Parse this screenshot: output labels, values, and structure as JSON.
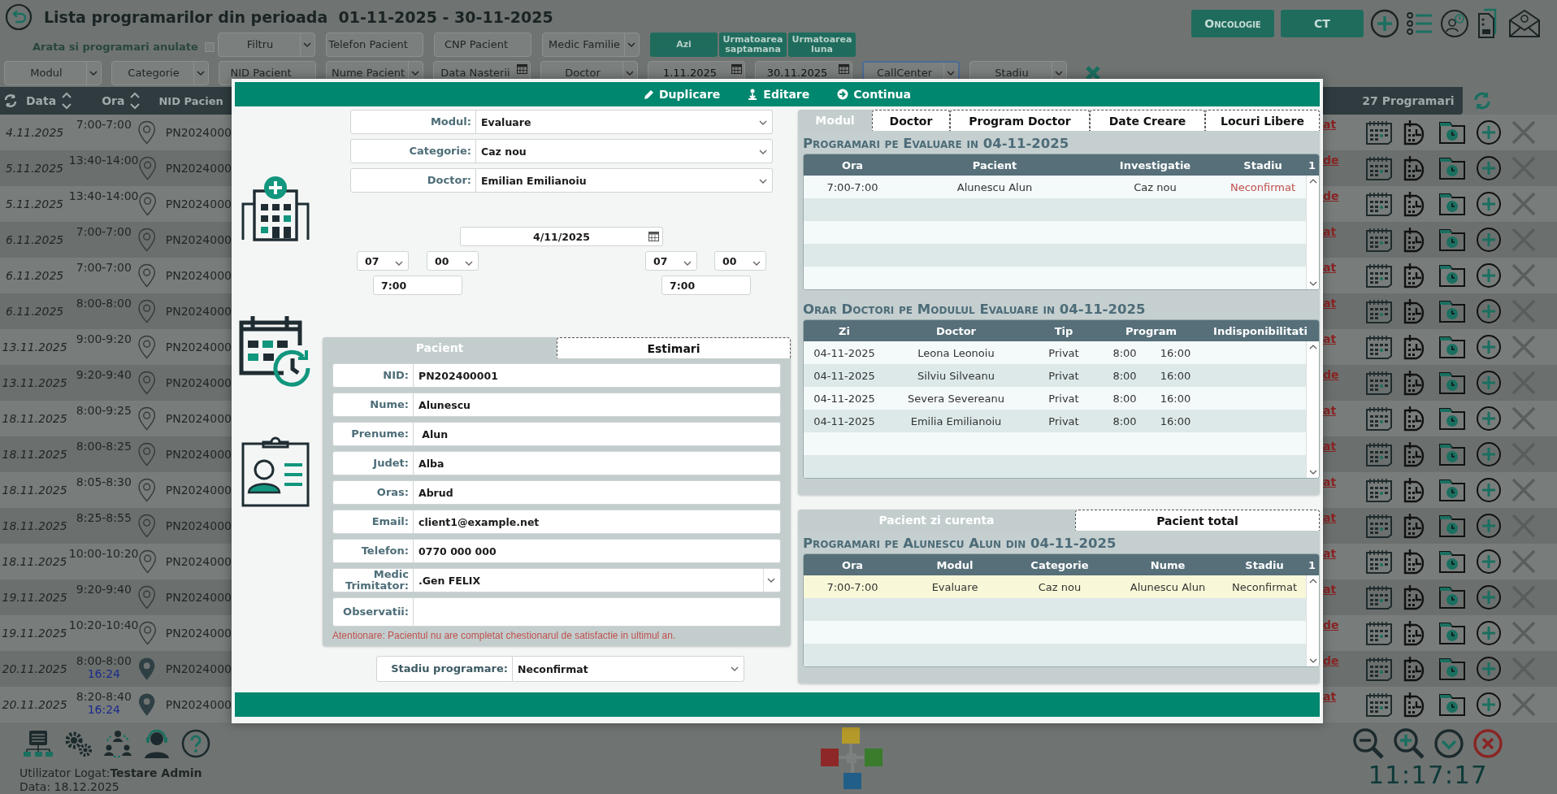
{
  "header": {
    "title": "Lista programarilor din perioada",
    "period": "01-11-2025 - 30-11-2025",
    "show_cancelled": {
      "label": "Arata si programari anulate",
      "checked": false
    }
  },
  "filters_row1": [
    {
      "kind": "select",
      "placeholder": "Filtru",
      "focused": false
    },
    {
      "kind": "input",
      "placeholder": "Telefon Pacient",
      "focused": false
    },
    {
      "kind": "input",
      "placeholder": "CNP Pacient",
      "focused": false
    },
    {
      "kind": "select",
      "placeholder": "Medic Familie",
      "focused": false
    }
  ],
  "period_buttons": [
    "Azi",
    "Urmatoarea saptamana",
    "Urmatoarea luna"
  ],
  "filters_row2": [
    {
      "kind": "select",
      "placeholder": "Modul",
      "focused": false
    },
    {
      "kind": "select",
      "placeholder": "Categorie",
      "focused": false
    },
    {
      "kind": "input",
      "placeholder": "NID Pacient",
      "focused": false
    },
    {
      "kind": "select",
      "placeholder": "Nume Pacient",
      "focused": false
    },
    {
      "kind": "date",
      "placeholder": "Data Nasterii",
      "focused": false
    },
    {
      "kind": "select",
      "placeholder": "Doctor",
      "focused": false
    },
    {
      "kind": "date",
      "value": "1.11.2025",
      "focused": false
    },
    {
      "kind": "date",
      "value": "30.11.2025",
      "focused": false
    },
    {
      "kind": "select",
      "placeholder": "CallCenter",
      "focused": true
    },
    {
      "kind": "select",
      "placeholder": "Stadiu",
      "focused": false
    }
  ],
  "quick_buttons": [
    "Oncologie",
    "CT"
  ],
  "list": {
    "columns": [
      "Data",
      "Ora",
      "NID Pacien"
    ],
    "count": "27 Programari",
    "rows": [
      {
        "date": "4.11.2025",
        "time": "7:00-7:00",
        "pin_filled": false,
        "nid": "PN2024000",
        "status": "at"
      },
      {
        "date": "5.11.2025",
        "time": "13:40-14:00",
        "pin_filled": false,
        "nid": "PN2024000",
        "status": "de"
      },
      {
        "date": "5.11.2025",
        "time": "13:40-14:00",
        "pin_filled": false,
        "nid": "PN2024000",
        "status": "de"
      },
      {
        "date": "6.11.2025",
        "time": "7:00-7:00",
        "pin_filled": false,
        "nid": "PN2024000",
        "status": "at"
      },
      {
        "date": "6.11.2025",
        "time": "7:00-7:00",
        "pin_filled": false,
        "nid": "PN2024000",
        "status": "at"
      },
      {
        "date": "6.11.2025",
        "time": "8:00-8:00",
        "pin_filled": false,
        "nid": "PN2024000",
        "status": "at"
      },
      {
        "date": "13.11.2025",
        "time": "9:00-9:20",
        "pin_filled": false,
        "nid": "PN2024000",
        "status": "at"
      },
      {
        "date": "13.11.2025",
        "time": "9:20-9:40",
        "pin_filled": false,
        "nid": "PN2024000",
        "status": "de"
      },
      {
        "date": "18.11.2025",
        "time": "8:00-9:25",
        "pin_filled": false,
        "nid": "PN2024000",
        "status": "at"
      },
      {
        "date": "18.11.2025",
        "time": "8:00-8:25",
        "pin_filled": false,
        "nid": "PN2024000",
        "status": "at"
      },
      {
        "date": "18.11.2025",
        "time": "8:05-8:30",
        "pin_filled": false,
        "nid": "PN2024000",
        "status": "at"
      },
      {
        "date": "18.11.2025",
        "time": "8:25-8:55",
        "pin_filled": false,
        "nid": "PN2024000",
        "status": "at"
      },
      {
        "date": "18.11.2025",
        "time": "10:00-10:20",
        "pin_filled": false,
        "nid": "PN2024000",
        "status": "at"
      },
      {
        "date": "19.11.2025",
        "time": "9:20-9:40",
        "pin_filled": false,
        "nid": "PN2024000",
        "status": "at"
      },
      {
        "date": "19.11.2025",
        "time": "10:20-10:40",
        "pin_filled": false,
        "nid": "PN2024000",
        "status": "de"
      },
      {
        "date": "20.11.2025",
        "time": "8:00-8:00",
        "arrival": "16:24",
        "pin_filled": true,
        "nid": "PN2024000",
        "status": "de"
      },
      {
        "date": "20.11.2025",
        "time": "8:20-8:40",
        "arrival": "16:24",
        "pin_filled": true,
        "nid": "PN2024000",
        "status": "at"
      }
    ]
  },
  "footer": {
    "user_label": "Utilizator Logat:",
    "user": "Testare Admin",
    "date": "Data: 18.12.2025",
    "clock": "11:17:17"
  },
  "modal": {
    "actions": [
      {
        "label": "Duplicare"
      },
      {
        "label": "Editare"
      },
      {
        "label": "Continua"
      }
    ],
    "selects": [
      {
        "label": "Modul:",
        "value": "Evaluare"
      },
      {
        "label": "Categorie:",
        "value": "Caz nou"
      },
      {
        "label": "Doctor:",
        "value": "Emilian Emilianoiu"
      }
    ],
    "date": "4/11/2025",
    "start": {
      "hour": "07",
      "minute": "00",
      "time": "7:00"
    },
    "end": {
      "hour": "07",
      "minute": "00",
      "time": "7:00"
    },
    "patient_tabs": [
      {
        "label": "Pacient",
        "selected": true
      },
      {
        "label": "Estimari",
        "selected": false
      }
    ],
    "patient_fields": [
      {
        "label": "NID:",
        "value": "PN202400001",
        "kind": "input"
      },
      {
        "label": "Nume:",
        "value": "Alunescu",
        "kind": "input"
      },
      {
        "label": "Prenume:",
        "value": " Alun",
        "kind": "input"
      },
      {
        "label": "Judet:",
        "value": "Alba",
        "kind": "input"
      },
      {
        "label": "Oras:",
        "value": "Abrud",
        "kind": "input"
      },
      {
        "label": "Email:",
        "value": "client1@example.net",
        "kind": "input"
      },
      {
        "label": "Telefon:",
        "value": "0770 000 000",
        "kind": "input"
      },
      {
        "label": "Medic Trimitator:",
        "value": ".Gen FELIX",
        "kind": "select"
      },
      {
        "label": "Observatii:",
        "kind": "textarea"
      }
    ],
    "warning": "Atentionare: Pacientul nu are completat chestionarul de satisfactie in ultimul an.",
    "stadiu": {
      "label": "Stadiu programare:",
      "value": "Neconfirmat"
    },
    "right_tabs": [
      {
        "label": "Modul",
        "selected": true
      },
      {
        "label": "Doctor",
        "selected": false
      },
      {
        "label": "Program Doctor",
        "selected": false
      },
      {
        "label": "Date Creare",
        "selected": false
      },
      {
        "label": "Locuri Libere",
        "selected": false
      }
    ],
    "module_table": {
      "title": "Programari pe Evaluare in 04-11-2025",
      "columns": [
        "Ora",
        "Pacient",
        "Investigatie",
        "Stadiu"
      ],
      "count": "1",
      "rows": [
        {
          "cells": [
            "7:00-7:00",
            "Alunescu Alun",
            "Caz nou",
            "Neconfirmat"
          ],
          "color": "#c0504d"
        }
      ]
    },
    "doctors_table": {
      "title": "Orar Doctori pe Modulul Evaluare in 04-11-2025",
      "columns": [
        "Zi",
        "Doctor",
        "Tip",
        "Program",
        "Indisponibilitati"
      ],
      "rows": [
        [
          "04-11-2025",
          "Leona Leonoiu",
          "Privat",
          "8:00",
          "16:00"
        ],
        [
          "04-11-2025",
          "Silviu Silveanu",
          "Privat",
          "8:00",
          "16:00"
        ],
        [
          "04-11-2025",
          "Severa Severeanu",
          "Privat",
          "8:00",
          "16:00"
        ],
        [
          "04-11-2025",
          "Emilia Emilianoiu",
          "Privat",
          "8:00",
          "16:00"
        ]
      ]
    },
    "patient_tabs2": [
      {
        "label": "Pacient zi curenta",
        "selected": true
      },
      {
        "label": "Pacient total",
        "selected": false
      }
    ],
    "patient_table": {
      "title": "Programari pe Alunescu Alun din 04-11-2025",
      "columns": [
        "Ora",
        "Modul",
        "Categorie",
        "Nume",
        "Stadiu"
      ],
      "count": "1",
      "rows": [
        {
          "cells": [
            "7:00-7:00",
            "Evaluare",
            "Caz nou",
            "Alunescu Alun",
            "Neconfirmat"
          ],
          "selected": true
        }
      ]
    }
  }
}
